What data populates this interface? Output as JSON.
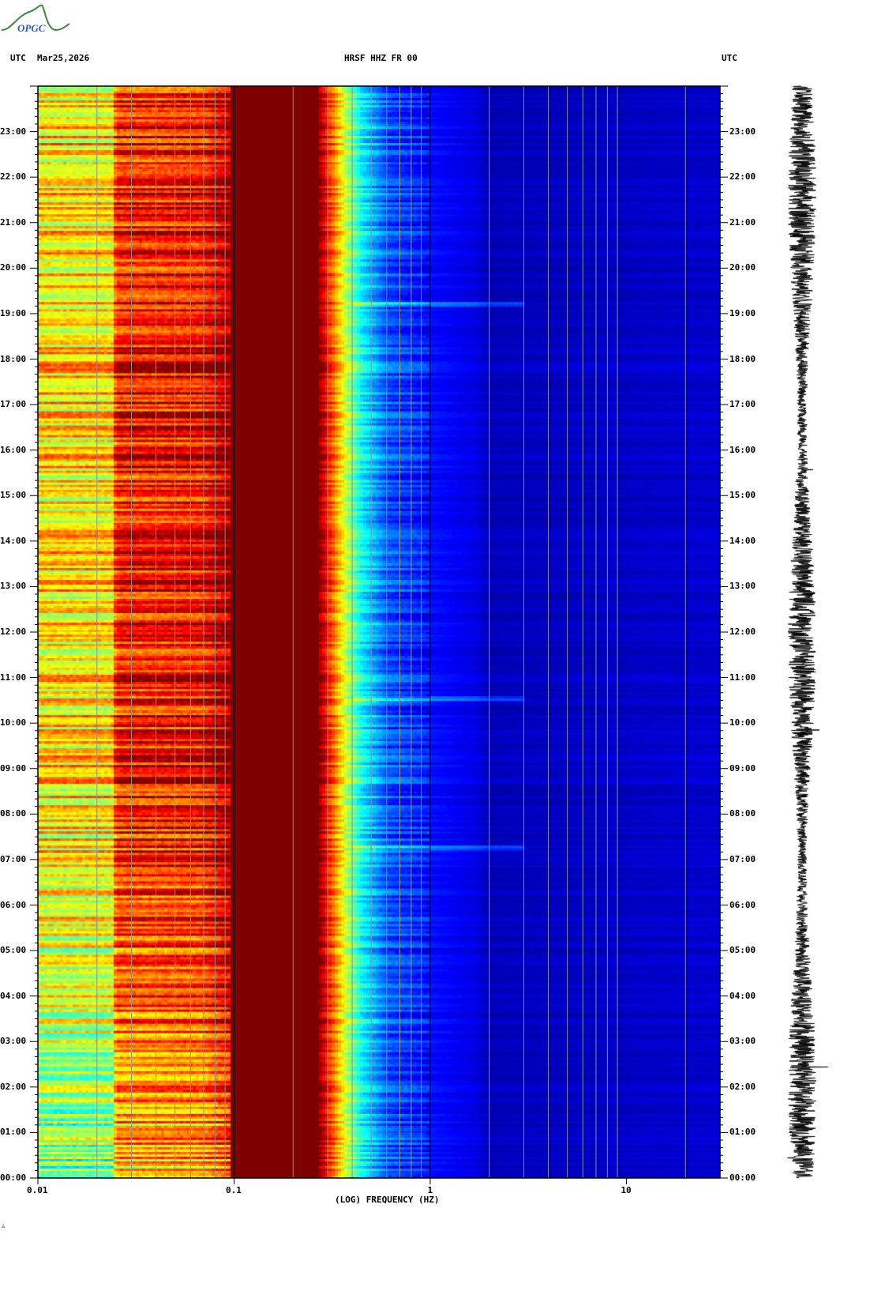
{
  "header": {
    "logo_text": "OPGC",
    "left_tz": "UTC",
    "date": "Mar25,2026",
    "station": "HRSF HHZ FR 00",
    "right_tz": "UTC"
  },
  "footer_mark": "∴",
  "colors": {
    "colormap": [
      "#00008b",
      "#0000ff",
      "#00ffff",
      "#ffff00",
      "#ff8000",
      "#ff0000",
      "#800000"
    ],
    "grid_minor": "#909090",
    "grid_major": "#000000"
  },
  "chart_data": {
    "type": "heatmap",
    "title": "HRSF HHZ FR 00",
    "date": "Mar25,2026",
    "xlabel": "(LOG) FREQUENCY (HZ)",
    "ylabel": "UTC",
    "xscale": "log",
    "xlim": [
      0.01,
      30
    ],
    "ylim_hours": [
      0,
      24
    ],
    "x_ticks": [
      {
        "value": 0.01,
        "label": "0.01"
      },
      {
        "value": 0.1,
        "label": "0.1"
      },
      {
        "value": 1,
        "label": "1"
      },
      {
        "value": 10,
        "label": "10"
      }
    ],
    "y_ticks": [
      "00:00",
      "01:00",
      "02:00",
      "03:00",
      "04:00",
      "05:00",
      "06:00",
      "07:00",
      "08:00",
      "09:00",
      "10:00",
      "11:00",
      "12:00",
      "13:00",
      "14:00",
      "15:00",
      "16:00",
      "17:00",
      "18:00",
      "19:00",
      "20:00",
      "21:00",
      "22:00",
      "23:00"
    ],
    "grid": true,
    "mean_power_profile": [
      {
        "freq": 0.01,
        "level": 0.66
      },
      {
        "freq": 0.024,
        "level": 0.66
      },
      {
        "freq": 0.025,
        "level": 0.86
      },
      {
        "freq": 0.07,
        "level": 0.88
      },
      {
        "freq": 0.1,
        "level": 1.0
      },
      {
        "freq": 0.27,
        "level": 1.0
      },
      {
        "freq": 0.32,
        "level": 0.78
      },
      {
        "freq": 0.38,
        "level": 0.55
      },
      {
        "freq": 0.45,
        "level": 0.38
      },
      {
        "freq": 0.6,
        "level": 0.22
      },
      {
        "freq": 1.0,
        "level": 0.14
      },
      {
        "freq": 1.7,
        "level": 0.1
      },
      {
        "freq": 2.0,
        "level": 0.06
      },
      {
        "freq": 30,
        "level": 0.08
      }
    ],
    "events_hours": [
      19.2,
      10.55,
      7.25
    ]
  }
}
